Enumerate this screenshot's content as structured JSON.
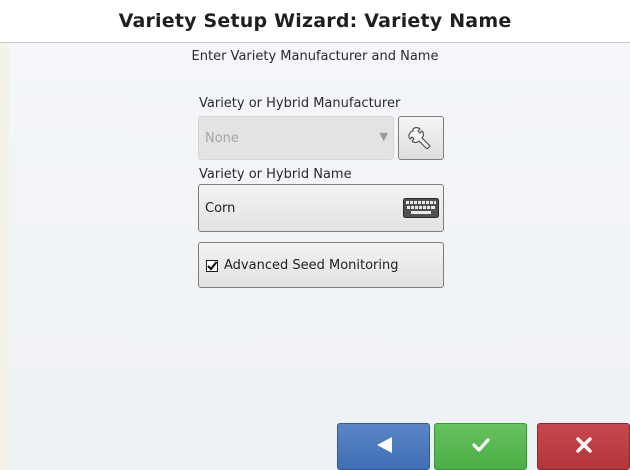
{
  "header": {
    "title": "Variety Setup Wizard:  Variety Name"
  },
  "main": {
    "instruction": "Enter Variety Manufacturer and Name",
    "manufacturer": {
      "label": "Variety or Hybrid Manufacturer",
      "value": "None",
      "dropdown_icon": "triangle-down-icon",
      "edit_icon": "wrench-icon"
    },
    "name": {
      "label": "Variety or Hybrid Name",
      "value": "Corn",
      "keyboard_icon": "keyboard-icon"
    },
    "advanced_seed_monitoring": {
      "label": "Advanced Seed Monitoring",
      "checked": true
    }
  },
  "footer": {
    "back_icon": "back-arrow-icon",
    "accept_icon": "check-icon",
    "cancel_icon": "close-icon",
    "colors": {
      "back": "#4a78bb",
      "accept": "#53b34c",
      "cancel": "#bb3c41"
    }
  }
}
